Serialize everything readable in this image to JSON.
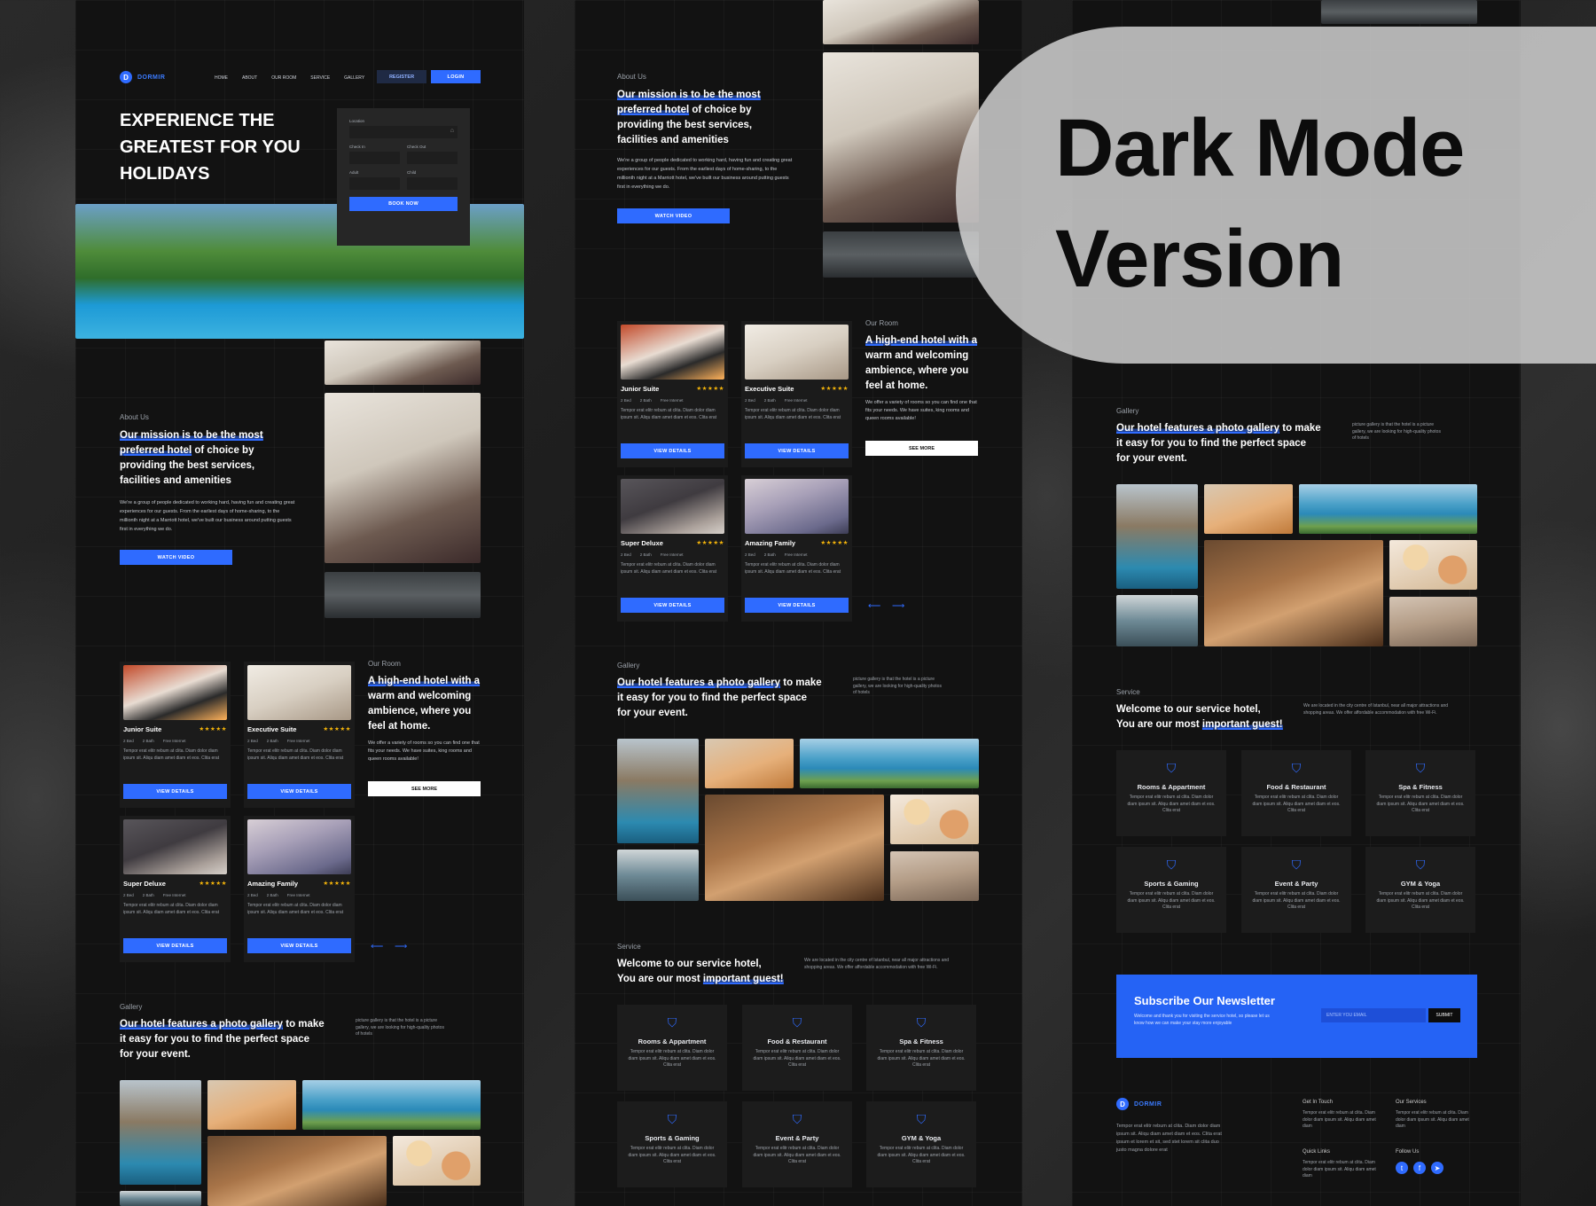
{
  "overlay": {
    "line1": "Dark Mode",
    "line2": "Version"
  },
  "brand": {
    "logo_letter": "D",
    "name": "DORMIR",
    "accent": "#2f6bff"
  },
  "nav": {
    "items": [
      "HOME",
      "ABOUT",
      "OUR ROOM",
      "SERVICE",
      "GALLERY"
    ],
    "register": "REGISTER",
    "login": "LOGIN"
  },
  "hero": {
    "title_line1": "EXPERIENCE THE",
    "title_line2": "GREATEST FOR YOU",
    "title_line3": "HOLIDAYS",
    "booking": {
      "location": "Location",
      "check_in": "Check In",
      "check_out": "Check Out",
      "adult": "Adult",
      "child": "Child",
      "book_now": "BOOK NOW"
    }
  },
  "about": {
    "eyebrow": "About Us",
    "headline_hl1": "Our mission is to be the most",
    "headline_hl2": "preferred hotel",
    "headline_rest1": " of choice by",
    "headline_line3": "providing the best services,",
    "headline_line4": "facilities and amenities",
    "body": "We're a group of people dedicated to working hard, having fun and creating great experiences for our guests. From the earliest days of home-sharing, to the millionth night at a Marriott hotel, we've built our business around putting guests first in everything we do.",
    "button": "WATCH VIDEO"
  },
  "rooms": {
    "eyebrow": "Our Room",
    "headline_hl": "A high-end hotel with a",
    "headline_line2": "warm and welcoming",
    "headline_line3": "ambience, where you",
    "headline_line4": "feel at home.",
    "body": "We offer a variety of rooms so you can find one that fits your needs. We have suites, king rooms and queen rooms available!",
    "see_more": "SEE MORE",
    "stars": "★★★★★",
    "meta": [
      "2 Bed",
      "2 Bath",
      "Free Internet"
    ],
    "desc": "Tempor erat elitr rebum at clita. Diam dolor diam ipsum sit. Aliqu diam amet diam et eos. Clita erat",
    "button": "VIEW DETAILS",
    "items": [
      {
        "name": "Junior Suite"
      },
      {
        "name": "Executive Suite"
      },
      {
        "name": "Super Deluxe"
      },
      {
        "name": "Amazing Family"
      }
    ],
    "prev": "⟵",
    "next": "⟶"
  },
  "gallery": {
    "eyebrow": "Gallery",
    "headline_hl": "Our hotel features a photo gallery",
    "headline_rest": " to make",
    "headline_line2": "it easy for you to find the perfect space",
    "headline_line3": "for your event.",
    "side": "picture gallery is that the hotel is a picture gallery, we are looking for high-quality photos of hotels"
  },
  "service": {
    "eyebrow": "Service",
    "headline_line1": "Welcome to our service hotel,",
    "headline_pre": "You are our most ",
    "headline_hl": "important guest!",
    "side": "We are located in the city centre of Istanbul, near all major attractions and shopping areas. We offer affordable accommodation with free Wi-Fi.",
    "desc": "Tempor erat elitr rebum at clita. Diam dolor diam ipsum sit. Aliqu diam amet diam et eos. Clita erat",
    "icon": "shield-icon",
    "items": [
      "Rooms & Appartment",
      "Food & Restaurant",
      "Spa & Fitness",
      "Sports & Gaming",
      "Event & Party",
      "GYM & Yoga"
    ]
  },
  "newsletter": {
    "title": "Subscribe Our Newsletter",
    "body": "Welcome and thank you for visiting the service hotel, so please let us know how we can make your stay more enjoyable",
    "placeholder": "ENTER YOU EMAIL",
    "button": "SUBMIT"
  },
  "footer": {
    "about": "Tempor erat elitr rebum at clita. Diam dolor diam ipsum sit. Aliqu diam amet diam et eos. Clita erat ipsum et lorem et sit, sed stet lorem sit clita duo justo magna dolore erat",
    "get_in_touch": "Get In Touch",
    "our_services": "Our Services",
    "quick_links": "Quick Links",
    "follow_us": "Follow Us",
    "col_text": "Tempor erat elitr rebum at clita. Diam dolor diam ipsum sit. Aliqu diam amet diam"
  }
}
